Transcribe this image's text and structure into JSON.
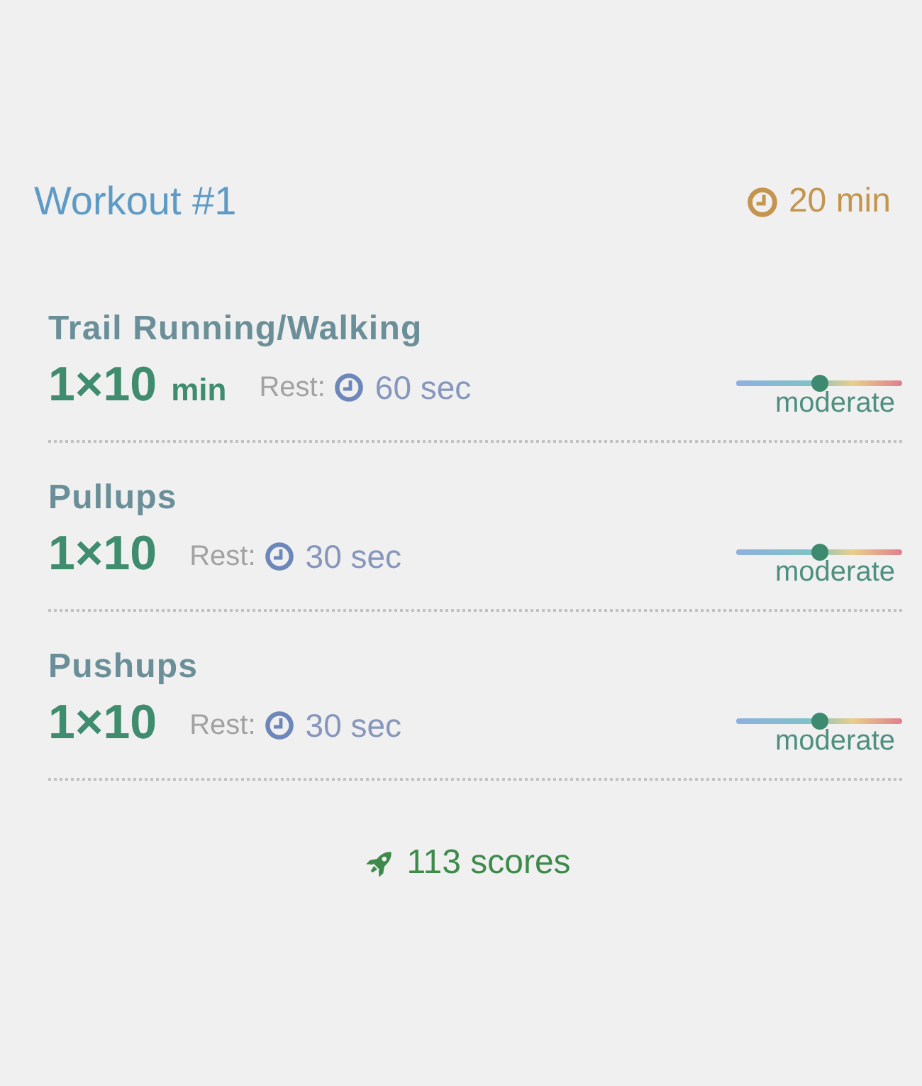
{
  "workout": {
    "title": "Workout #1",
    "duration": "20 min"
  },
  "exercises": [
    {
      "name": "Trail Running/Walking",
      "sets": "1×10",
      "unit": "min",
      "rest_label": "Rest:",
      "rest": "60 sec",
      "intensity": {
        "level": 0.5,
        "label": "moderate"
      }
    },
    {
      "name": "Pullups",
      "sets": "1×10",
      "rest_label": "Rest:",
      "rest": "30 sec",
      "intensity": {
        "level": 0.5,
        "label": "moderate"
      }
    },
    {
      "name": "Pushups",
      "sets": "1×10",
      "rest_label": "Rest:",
      "rest": "30 sec",
      "intensity": {
        "level": 0.5,
        "label": "moderate"
      }
    }
  ],
  "scores": "113 scores"
}
